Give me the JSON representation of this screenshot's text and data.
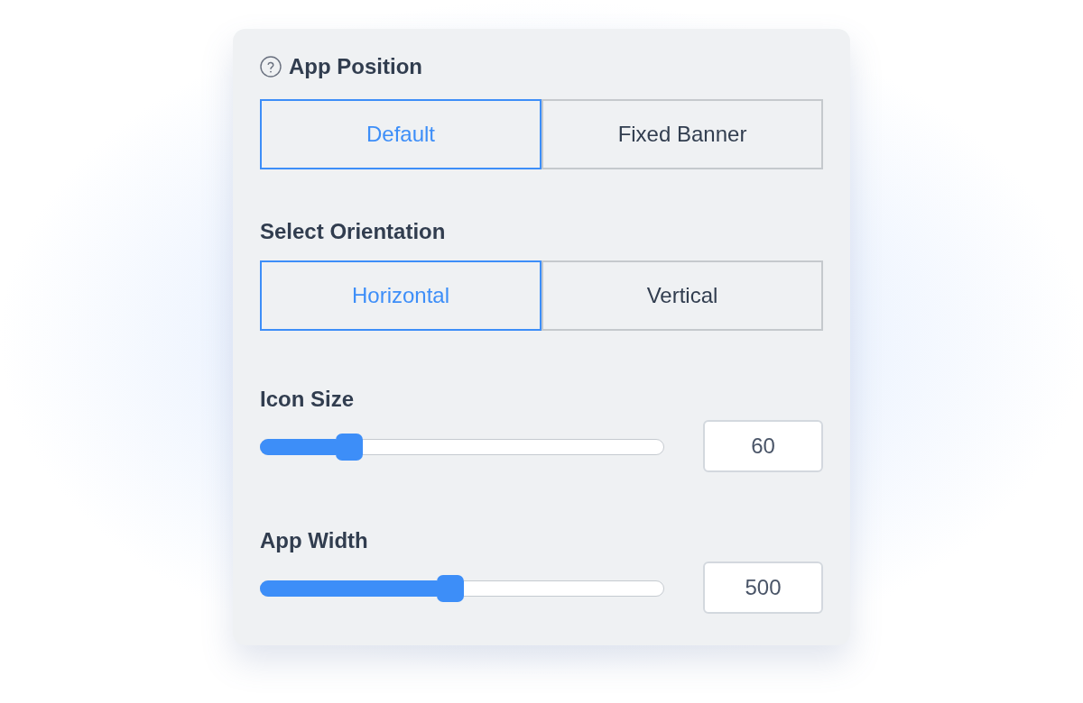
{
  "sections": [
    {
      "kind": "segmented",
      "title": "App Position",
      "help": true,
      "options": [
        {
          "label": "Default",
          "selected": true
        },
        {
          "label": "Fixed Banner",
          "selected": false
        }
      ]
    },
    {
      "kind": "segmented",
      "title": "Select Orientation",
      "options": [
        {
          "label": "Horizontal",
          "selected": true
        },
        {
          "label": "Vertical",
          "selected": false
        }
      ]
    },
    {
      "kind": "slider",
      "title": "Icon Size",
      "level": 0.22,
      "value": "60"
    },
    {
      "kind": "slider",
      "title": "App Width",
      "level": 0.47,
      "value": "500"
    }
  ]
}
